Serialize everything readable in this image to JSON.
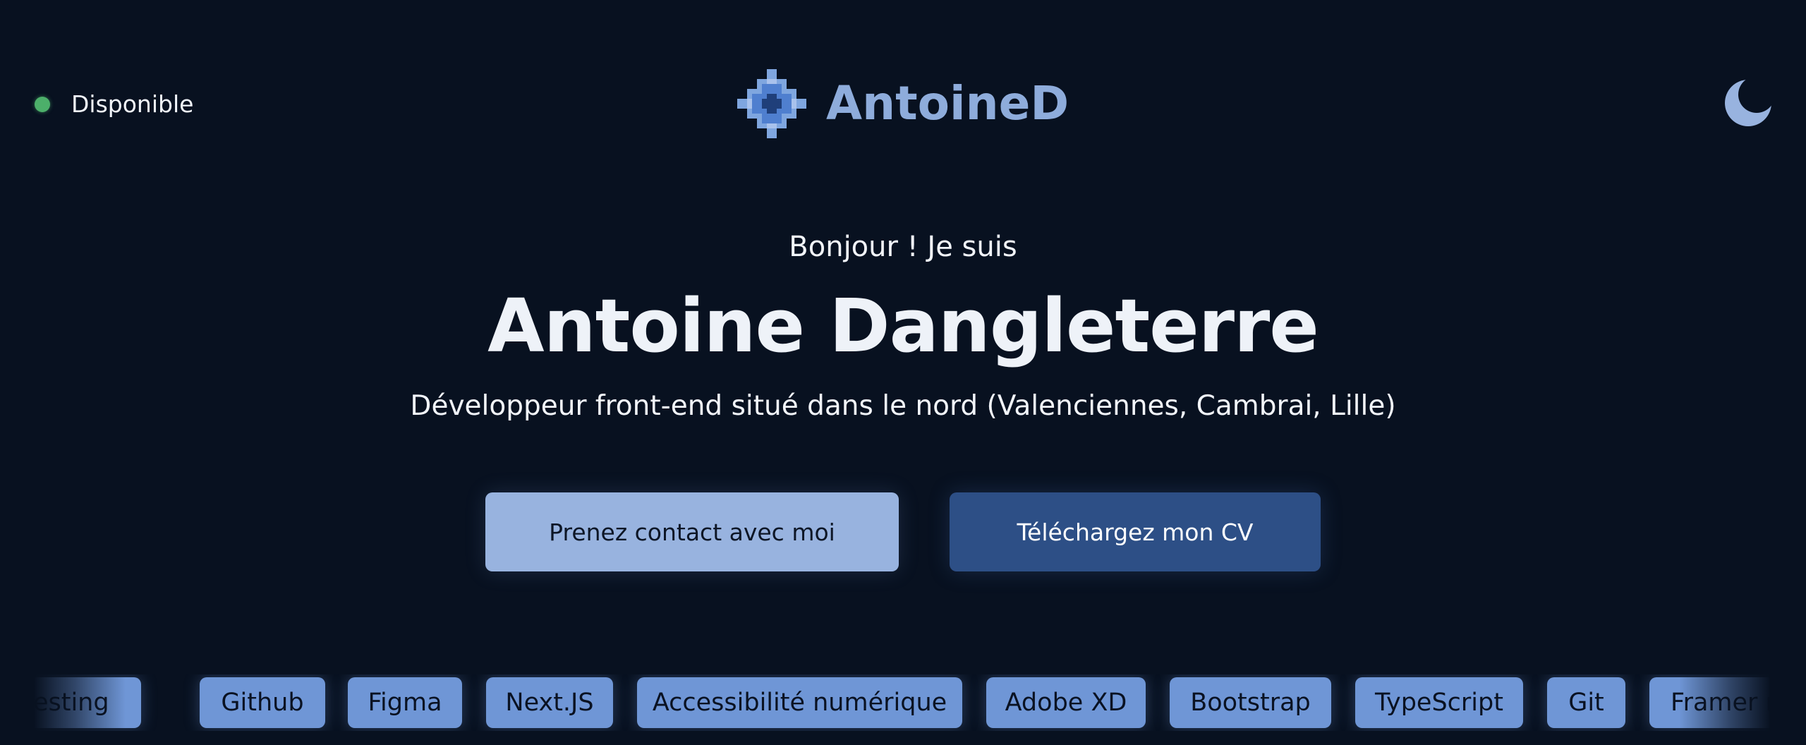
{
  "header": {
    "status": {
      "label": "Disponible",
      "color": "#4caf6a"
    },
    "logo": {
      "text": "AntoineD",
      "icon": "pixel-diamond-icon",
      "color": "#8eacdb"
    },
    "theme_toggle": {
      "icon": "moon-icon"
    }
  },
  "hero": {
    "greeting": "Bonjour ! Je suis",
    "name": "Antoine Dangleterre",
    "tagline": "Développeur front-end situé dans le nord (Valenciennes, Cambrai, Lille)"
  },
  "actions": {
    "contact_label": "Prenez contact avec moi",
    "cv_label": "Téléchargez mon CV"
  },
  "skills": {
    "items": [
      "React testing",
      "Github",
      "Figma",
      "Next.JS",
      "Accessibilité numérique",
      "Adobe XD",
      "Bootstrap",
      "TypeScript",
      "Git",
      "Framer motion"
    ]
  },
  "colors": {
    "background": "#081120",
    "accent_light": "#98b3df",
    "accent_dark": "#2d4f86",
    "chip": "#6f96d6"
  }
}
